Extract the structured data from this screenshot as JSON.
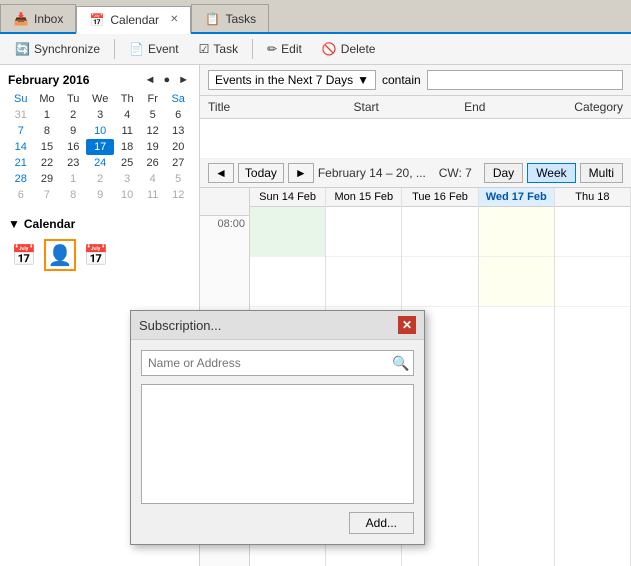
{
  "tabs": [
    {
      "id": "inbox",
      "label": "Inbox",
      "icon": "📥",
      "active": false
    },
    {
      "id": "calendar",
      "label": "Calendar",
      "icon": "📅",
      "active": true,
      "closable": true
    },
    {
      "id": "tasks",
      "label": "Tasks",
      "icon": "📋",
      "active": false
    }
  ],
  "toolbar": {
    "sync_label": "Synchronize",
    "event_label": "Event",
    "task_label": "Task",
    "edit_label": "Edit",
    "delete_label": "Delete"
  },
  "mini_calendar": {
    "month": "February",
    "year": "2016",
    "day_headers": [
      "Su",
      "Mo",
      "Tu",
      "We",
      "Th",
      "Fr",
      "Sa"
    ],
    "weeks": [
      [
        {
          "day": "31",
          "other": true
        },
        {
          "day": "1"
        },
        {
          "day": "2"
        },
        {
          "day": "3"
        },
        {
          "day": "4"
        },
        {
          "day": "5"
        },
        {
          "day": "6"
        }
      ],
      [
        {
          "day": "7"
        },
        {
          "day": "8"
        },
        {
          "day": "9"
        },
        {
          "day": "10",
          "weekend_hi": true
        },
        {
          "day": "11"
        },
        {
          "day": "12"
        },
        {
          "day": "13"
        }
      ],
      [
        {
          "day": "14"
        },
        {
          "day": "15"
        },
        {
          "day": "16"
        },
        {
          "day": "17",
          "selected": true
        },
        {
          "day": "18"
        },
        {
          "day": "19"
        },
        {
          "day": "20"
        }
      ],
      [
        {
          "day": "21"
        },
        {
          "day": "22"
        },
        {
          "day": "23"
        },
        {
          "day": "24",
          "weekend_hi": true
        },
        {
          "day": "25"
        },
        {
          "day": "26"
        },
        {
          "day": "27"
        }
      ],
      [
        {
          "day": "28"
        },
        {
          "day": "29"
        },
        {
          "day": "1",
          "other": true
        },
        {
          "day": "2",
          "other": true
        },
        {
          "day": "3",
          "other": true
        },
        {
          "day": "4",
          "other": true
        },
        {
          "day": "5",
          "other": true
        }
      ],
      [
        {
          "day": "6",
          "other": true
        },
        {
          "day": "7",
          "other": true
        },
        {
          "day": "8",
          "other": true
        },
        {
          "day": "9",
          "other": true
        },
        {
          "day": "10",
          "other": true
        },
        {
          "day": "11",
          "other": true
        },
        {
          "day": "12",
          "other": true
        }
      ]
    ]
  },
  "calendar_section": {
    "label": "Calendar",
    "collapse_icon": "▼"
  },
  "filter_bar": {
    "dropdown_label": "Events in the Next 7 Days",
    "contain_label": "contain",
    "dropdown_arrow": "▼"
  },
  "event_table": {
    "columns": [
      "Title",
      "Start",
      "End",
      "Category"
    ]
  },
  "cal_nav": {
    "prev_label": "◄",
    "today_label": "Today",
    "next_label": "►",
    "range_label": "February 14 – 20, ...",
    "cw_label": "CW: 7",
    "views": [
      "Day",
      "Week",
      "Multi"
    ]
  },
  "week_days": [
    {
      "label": "Sun 14 Feb",
      "today": false
    },
    {
      "label": "Mon 15 Feb",
      "today": false
    },
    {
      "label": "Tue 16 Feb",
      "today": false
    },
    {
      "label": "Wed 17 Feb",
      "today": true
    },
    {
      "label": "Thu 18",
      "today": false
    }
  ],
  "time_labels": [
    "",
    "08:00",
    "",
    ""
  ],
  "dialog": {
    "title": "Subscription...",
    "close_icon": "✕",
    "search_placeholder": "Name or Address",
    "search_icon": "🔍",
    "add_label": "Add..."
  }
}
